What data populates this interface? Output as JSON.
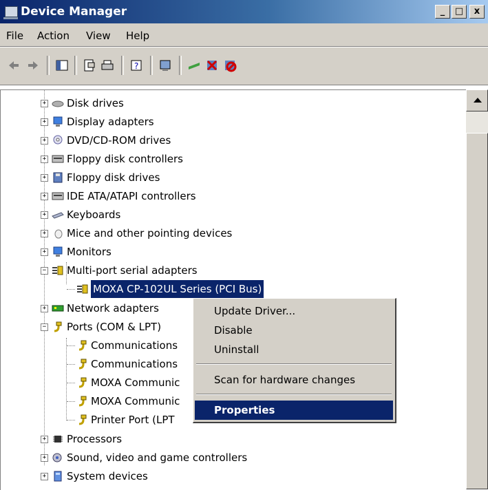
{
  "window": {
    "title": "Device Manager"
  },
  "window_controls": {
    "minimize": "_",
    "maximize": "□",
    "close": "x"
  },
  "menu": [
    "File",
    "Action",
    "View",
    "Help"
  ],
  "tree": {
    "categories": [
      {
        "label": "Disk drives",
        "icon": "disk-drive-icon"
      },
      {
        "label": "Display adapters",
        "icon": "display-adapter-icon"
      },
      {
        "label": "DVD/CD-ROM drives",
        "icon": "dvd-drive-icon"
      },
      {
        "label": "Floppy disk controllers",
        "icon": "floppy-controller-icon"
      },
      {
        "label": "Floppy disk drives",
        "icon": "floppy-drive-icon"
      },
      {
        "label": "IDE ATA/ATAPI controllers",
        "icon": "ide-controller-icon"
      },
      {
        "label": "Keyboards",
        "icon": "keyboard-icon"
      },
      {
        "label": "Mice and other pointing devices",
        "icon": "mouse-icon"
      },
      {
        "label": "Monitors",
        "icon": "monitor-icon"
      },
      {
        "label": "Multi-port serial adapters",
        "icon": "serial-adapter-icon"
      },
      {
        "label": "MOXA CP-102UL Series (PCI Bus)",
        "icon": "serial-adapter-icon"
      },
      {
        "label": "Network adapters",
        "icon": "network-adapter-icon"
      },
      {
        "label": "Ports (COM & LPT)",
        "icon": "port-icon"
      },
      {
        "label": "Communications",
        "icon": "port-icon"
      },
      {
        "label": "Communications",
        "icon": "port-icon"
      },
      {
        "label": "MOXA Communic",
        "icon": "port-icon"
      },
      {
        "label": "MOXA Communic",
        "icon": "port-icon"
      },
      {
        "label": "Printer Port (LPT",
        "icon": "port-icon"
      },
      {
        "label": "Processors",
        "icon": "processor-icon"
      },
      {
        "label": "Sound, video and game controllers",
        "icon": "sound-icon"
      },
      {
        "label": "System devices",
        "icon": "system-device-icon"
      }
    ],
    "selected_label": "MOXA CP-102UL Series (PCI Bus)"
  },
  "context_menu": {
    "items": [
      "Update Driver...",
      "Disable",
      "Uninstall",
      "Scan for hardware changes",
      "Properties"
    ],
    "highlighted": "Properties"
  }
}
